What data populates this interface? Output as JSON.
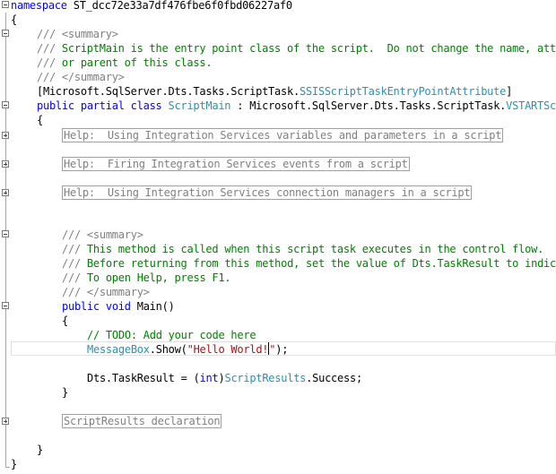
{
  "lines": {
    "ns_kw": "namespace",
    "ns_name": " ST_dcc72e33a7df476fbe6f0fbd06227af0",
    "open_brace": "{",
    "sum1_slashes": "/// ",
    "sum1_tag": "<summary>",
    "doc1_slashes": "/// ",
    "doc1_text": "ScriptMain is the entry point class of the script.  Do not change the name, attributes,",
    "doc2_slashes": "/// ",
    "doc2_text": "or parent of this class.",
    "sum1_close_slashes": "/// ",
    "sum1_close_tag": "</summary>",
    "attr_open": "[Microsoft.SqlServer.Dts.Tasks.ScriptTask.",
    "attr_type": "SSISScriptTaskEntryPointAttribute",
    "attr_close": "]",
    "cls_kw1": "public",
    "cls_kw2": "partial",
    "cls_kw3": "class",
    "cls_name": "ScriptMain",
    "cls_base_prefix": " : Microsoft.SqlServer.Dts.Tasks.ScriptTask.",
    "cls_base_type": "VSTARTScriptObjectModelBase",
    "cls_brace": "{",
    "help1": "Help:  Using Integration Services variables and parameters in a script",
    "help2": "Help:  Firing Integration Services events from a script",
    "help3": "Help:  Using Integration Services connection managers in a script",
    "sum2_slashes": "/// ",
    "sum2_tag": "<summary>",
    "doc3_slashes": "/// ",
    "doc3_text": "This method is called when this script task executes in the control flow.",
    "doc4_slashes": "/// ",
    "doc4_text": "Before returning from this method, set the value of Dts.TaskResult to indicate success or failure.",
    "doc5_slashes": "/// ",
    "doc5_text": "To open Help, press F1.",
    "sum2_close_slashes": "/// ",
    "sum2_close_tag": "</summary>",
    "main_kw1": "public",
    "main_kw2": "void",
    "main_name": " Main()",
    "main_brace": "{",
    "todo": "// TODO: Add your code here",
    "msg_type": "MessageBox",
    "msg_call": ".Show(",
    "msg_str": "\"Hello World!",
    "msg_str_end": "\"",
    "msg_end": ");",
    "res_prefix": "Dts.TaskResult = (",
    "res_kw": "int",
    "res_mid": ")",
    "res_type": "ScriptResults",
    "res_end": ".Success;",
    "main_close": "}",
    "decl": "ScriptResults declaration",
    "cls_close": "}",
    "ns_close": "}"
  },
  "colors": {
    "keyword": "#0000ff",
    "type": "#2b91af",
    "comment": "#008000",
    "xml_doc_tag": "#808080",
    "string": "#a31515",
    "collapsed_region": "#808080"
  },
  "icons": {
    "collapse": "fold-minus-icon",
    "expand": "fold-plus-icon"
  }
}
